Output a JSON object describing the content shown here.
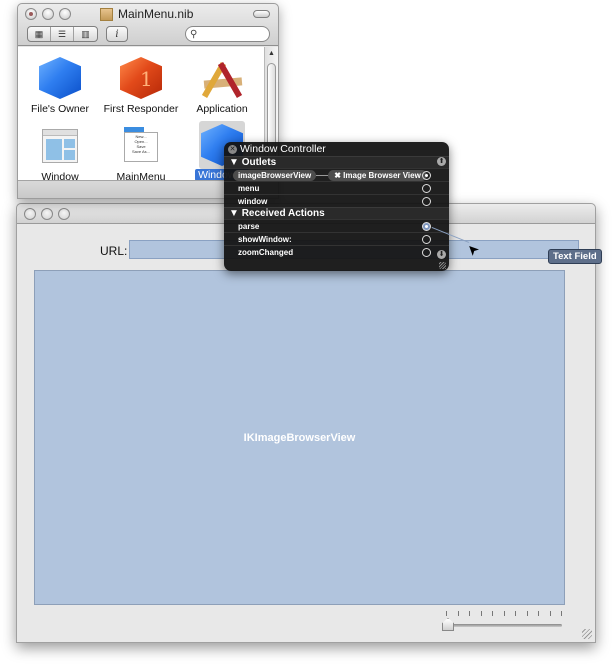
{
  "nib_window": {
    "title": "MainMenu.nib",
    "view_modes": [
      "icon-view",
      "list-view",
      "column-view"
    ],
    "info_label": "i",
    "search_placeholder": "",
    "objects": [
      {
        "label": "File's Owner",
        "icon": "blue-cube-icon"
      },
      {
        "label": "First Responder",
        "icon": "red-cube-icon"
      },
      {
        "label": "Application",
        "icon": "application-icon"
      },
      {
        "label": "Window",
        "icon": "window-icon"
      },
      {
        "label": "MainMenu",
        "icon": "menu-icon"
      },
      {
        "label": "Window C",
        "icon": "blue-cube-icon",
        "selected": true
      }
    ],
    "menu_preview": [
      "New...",
      "Open...",
      "Save",
      "Save As..."
    ]
  },
  "connections_panel": {
    "title": "Window Controller",
    "outlets_header": "Outlets",
    "outlets": [
      {
        "name": "imageBrowserView",
        "connected_to": "Image Browser View",
        "connected": true
      },
      {
        "name": "menu",
        "connected": false
      },
      {
        "name": "window",
        "connected": false
      }
    ],
    "actions_header": "Received Actions",
    "actions": [
      {
        "name": "parse",
        "connected": true,
        "dragging": true
      },
      {
        "name": "showWindow:",
        "connected": false
      },
      {
        "name": "zoomChanged",
        "connected": false
      }
    ]
  },
  "main_window": {
    "url_label": "URL:",
    "url_value": "",
    "browser_view_label": "IKImageBrowserView",
    "zoom_slider": {
      "value_fraction": 0.0,
      "tick_count": 11
    }
  },
  "tooltip": "Text Field"
}
